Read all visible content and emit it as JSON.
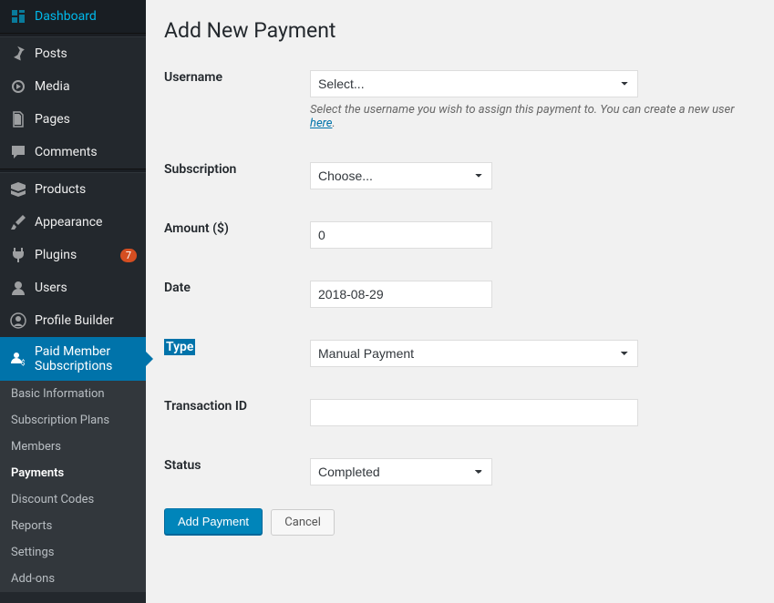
{
  "sidebar": {
    "items": [
      {
        "label": "Dashboard",
        "icon": "dashboard"
      },
      {
        "label": "Posts",
        "icon": "pin"
      },
      {
        "label": "Media",
        "icon": "media"
      },
      {
        "label": "Pages",
        "icon": "page"
      },
      {
        "label": "Comments",
        "icon": "comment"
      },
      {
        "label": "Products",
        "icon": "product"
      },
      {
        "label": "Appearance",
        "icon": "brush"
      },
      {
        "label": "Plugins",
        "icon": "plugin",
        "badge": "7"
      },
      {
        "label": "Users",
        "icon": "user"
      },
      {
        "label": "Profile Builder",
        "icon": "profile"
      },
      {
        "label": "Paid Member Subscriptions",
        "icon": "pms",
        "active": true
      }
    ],
    "submenu": [
      {
        "label": "Basic Information"
      },
      {
        "label": "Subscription Plans"
      },
      {
        "label": "Members"
      },
      {
        "label": "Payments",
        "active": true
      },
      {
        "label": "Discount Codes"
      },
      {
        "label": "Reports"
      },
      {
        "label": "Settings"
      },
      {
        "label": "Add-ons"
      }
    ]
  },
  "page": {
    "title": "Add New Payment"
  },
  "form": {
    "username": {
      "label": "Username",
      "placeholder": "Select...",
      "help_prefix": "Select the username you wish to assign this payment to. You can create a new user ",
      "help_link": "here",
      "help_suffix": "."
    },
    "subscription": {
      "label": "Subscription",
      "placeholder": "Choose..."
    },
    "amount": {
      "label": "Amount ($)",
      "value": "0"
    },
    "date": {
      "label": "Date",
      "value": "2018-08-29"
    },
    "type": {
      "label": "Type",
      "value": "Manual Payment"
    },
    "transaction_id": {
      "label": "Transaction ID",
      "value": ""
    },
    "status": {
      "label": "Status",
      "value": "Completed"
    }
  },
  "buttons": {
    "submit": "Add Payment",
    "cancel": "Cancel"
  }
}
